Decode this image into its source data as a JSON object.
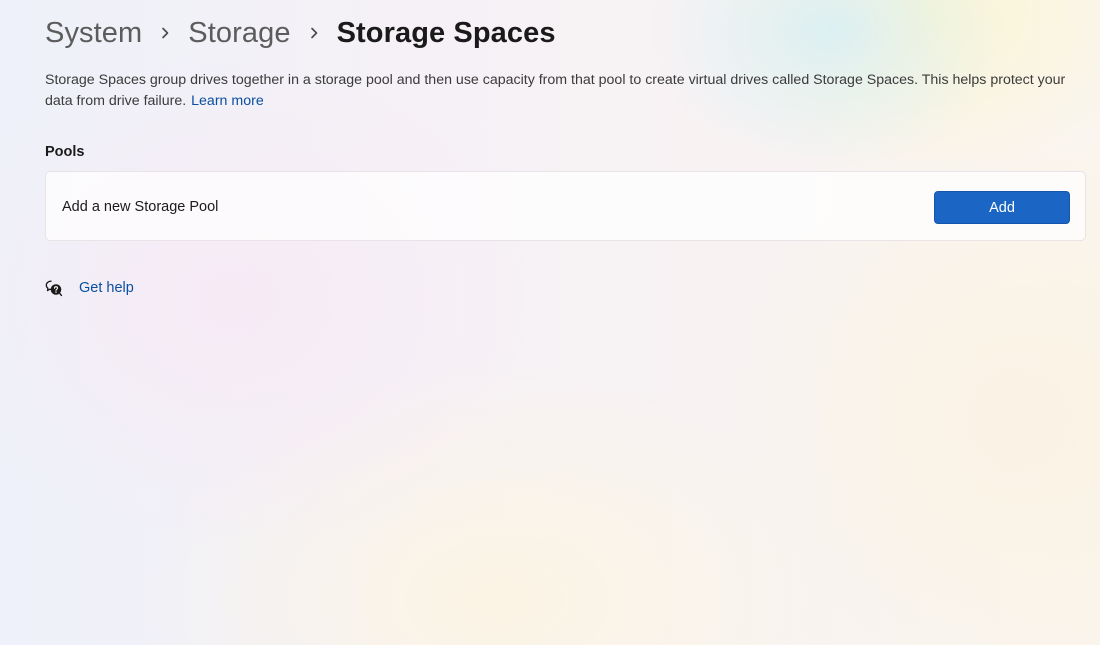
{
  "breadcrumb": {
    "items": [
      "System",
      "Storage",
      "Storage Spaces"
    ],
    "separator_icon": "chevron-right-icon"
  },
  "description": {
    "text": "Storage Spaces group drives together in a storage pool and then use capacity from that pool to create virtual drives called Storage Spaces. This helps protect your data from drive failure.",
    "link_label": "Learn more"
  },
  "pools": {
    "title": "Pools",
    "add_pool_label": "Add a new Storage Pool",
    "add_button_label": "Add"
  },
  "help": {
    "icon": "get-help-icon",
    "label": "Get help"
  },
  "colors": {
    "accent": "#1b65c4",
    "link": "#0a4fa0"
  }
}
